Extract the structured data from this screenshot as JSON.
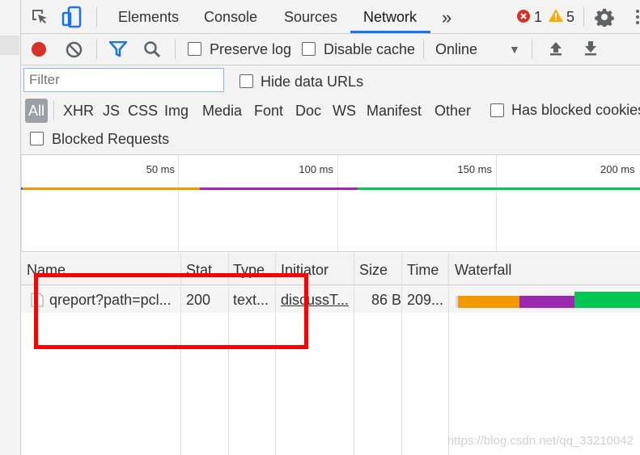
{
  "tabs": [
    "Elements",
    "Console",
    "Sources",
    "Network"
  ],
  "more_tabs_glyph": "»",
  "error_count": "1",
  "warning_count": "5",
  "toolbar": {
    "preserve_log": "Preserve log",
    "disable_cache": "Disable cache",
    "throttle": "Online",
    "throttle_arrow": "▼"
  },
  "filter": {
    "placeholder": "Filter",
    "hide_data_urls": "Hide data URLs",
    "types": [
      "All",
      "XHR",
      "JS",
      "CSS",
      "Img",
      "Media",
      "Font",
      "Doc",
      "WS",
      "Manifest",
      "Other"
    ],
    "has_blocked_cookies": "Has blocked cookies",
    "blocked_requests": "Blocked Requests"
  },
  "overview": {
    "ticks": [
      "50 ms",
      "100 ms",
      "150 ms",
      "200 ms"
    ],
    "colors": {
      "waiting": "#f29900",
      "queue": "#9c27b0",
      "download": "#00c853"
    }
  },
  "table": {
    "headers": [
      "Name",
      "Stat",
      "Type",
      "Initiator",
      "Size",
      "Time",
      "Waterfall"
    ],
    "rows": [
      {
        "name": "qreport?path=pcl...",
        "status": "200",
        "type": "text...",
        "initiator": "discussT...",
        "size": "86 B",
        "time": "209..."
      }
    ]
  },
  "watermark": "https://blog.csdn.net/qq_33210042"
}
